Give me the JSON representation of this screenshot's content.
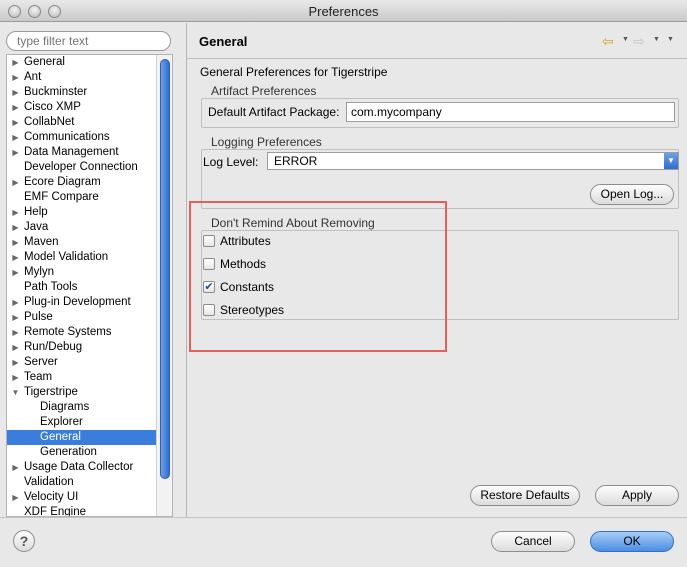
{
  "window": {
    "title": "Preferences"
  },
  "sidebar": {
    "filter_placeholder": "type filter text",
    "items": [
      {
        "label": "General",
        "expandable": true,
        "level": 0
      },
      {
        "label": "Ant",
        "expandable": true,
        "level": 0
      },
      {
        "label": "Buckminster",
        "expandable": true,
        "level": 0
      },
      {
        "label": "Cisco XMP",
        "expandable": true,
        "level": 0
      },
      {
        "label": "CollabNet",
        "expandable": true,
        "level": 0
      },
      {
        "label": "Communications",
        "expandable": true,
        "level": 0
      },
      {
        "label": "Data Management",
        "expandable": true,
        "level": 0
      },
      {
        "label": "Developer Connection",
        "expandable": false,
        "level": 0
      },
      {
        "label": "Ecore Diagram",
        "expandable": true,
        "level": 0
      },
      {
        "label": "EMF Compare",
        "expandable": false,
        "level": 0
      },
      {
        "label": "Help",
        "expandable": true,
        "level": 0
      },
      {
        "label": "Java",
        "expandable": true,
        "level": 0
      },
      {
        "label": "Maven",
        "expandable": true,
        "level": 0
      },
      {
        "label": "Model Validation",
        "expandable": true,
        "level": 0
      },
      {
        "label": "Mylyn",
        "expandable": true,
        "level": 0
      },
      {
        "label": "Path Tools",
        "expandable": false,
        "level": 0
      },
      {
        "label": "Plug-in Development",
        "expandable": true,
        "level": 0
      },
      {
        "label": "Pulse",
        "expandable": true,
        "level": 0
      },
      {
        "label": "Remote Systems",
        "expandable": true,
        "level": 0
      },
      {
        "label": "Run/Debug",
        "expandable": true,
        "level": 0
      },
      {
        "label": "Server",
        "expandable": true,
        "level": 0
      },
      {
        "label": "Team",
        "expandable": true,
        "level": 0
      },
      {
        "label": "Tigerstripe",
        "expandable": true,
        "expanded": true,
        "level": 0
      },
      {
        "label": "Diagrams",
        "expandable": false,
        "level": 1
      },
      {
        "label": "Explorer",
        "expandable": false,
        "level": 1
      },
      {
        "label": "General",
        "expandable": false,
        "level": 1,
        "selected": true
      },
      {
        "label": "Generation",
        "expandable": false,
        "level": 1
      },
      {
        "label": "Usage Data Collector",
        "expandable": true,
        "level": 0
      },
      {
        "label": "Validation",
        "expandable": false,
        "level": 0
      },
      {
        "label": "Velocity UI",
        "expandable": true,
        "level": 0
      },
      {
        "label": "XDF Engine",
        "expandable": false,
        "level": 0
      }
    ]
  },
  "main": {
    "title": "General",
    "description": "General Preferences for Tigerstripe",
    "artifact": {
      "group_label": "Artifact Preferences",
      "package_label": "Default Artifact Package:",
      "package_value": "com.mycompany"
    },
    "logging": {
      "group_label": "Logging Preferences",
      "level_label": "Log Level:",
      "level_value": "ERROR",
      "open_log_label": "Open Log..."
    },
    "remind": {
      "group_label": "Don't Remind About Removing",
      "options": [
        {
          "label": "Attributes",
          "checked": false
        },
        {
          "label": "Methods",
          "checked": false
        },
        {
          "label": "Constants",
          "checked": true
        },
        {
          "label": "Stereotypes",
          "checked": false
        }
      ]
    },
    "restore_defaults_label": "Restore Defaults",
    "apply_label": "Apply"
  },
  "footer": {
    "cancel_label": "Cancel",
    "ok_label": "OK"
  },
  "icons": {
    "back": "arrow-left-icon",
    "forward": "arrow-right-icon",
    "help": "help-icon"
  },
  "colors": {
    "selection": "#3b7ddd",
    "highlight_box": "#e4605d"
  }
}
